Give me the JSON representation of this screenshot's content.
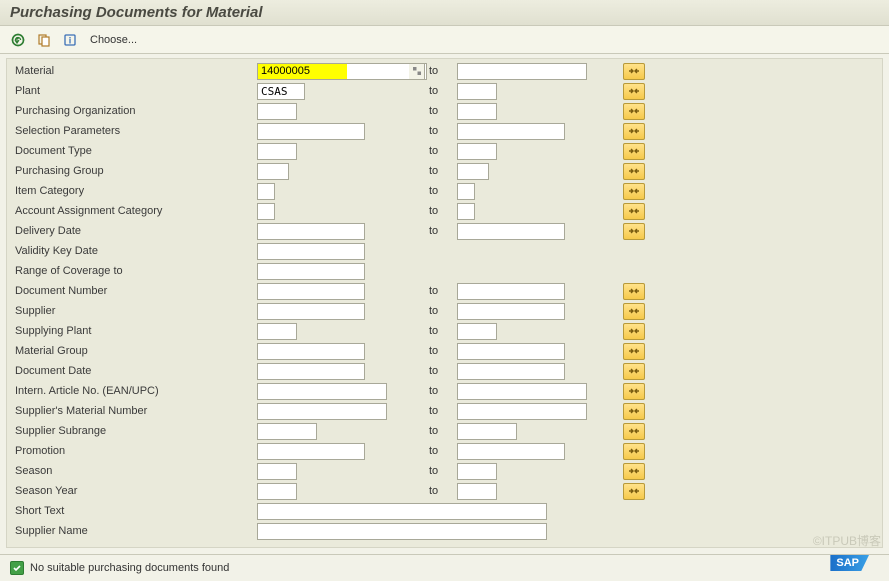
{
  "title": "Purchasing Documents for Material",
  "toolbar": {
    "choose": "Choose..."
  },
  "to": "to",
  "fields": {
    "material": {
      "label": "Material",
      "from": "14000005",
      "to": ""
    },
    "plant": {
      "label": "Plant",
      "from": "CSAS",
      "to": ""
    },
    "porg": {
      "label": "Purchasing Organization",
      "from": "",
      "to": ""
    },
    "selparam": {
      "label": "Selection Parameters",
      "from": "",
      "to": ""
    },
    "doctype": {
      "label": "Document Type",
      "from": "",
      "to": ""
    },
    "pgrp": {
      "label": "Purchasing Group",
      "from": "",
      "to": ""
    },
    "itemcat": {
      "label": "Item Category",
      "from": "",
      "to": ""
    },
    "acctasgn": {
      "label": "Account Assignment Category",
      "from": "",
      "to": ""
    },
    "deldate": {
      "label": "Delivery Date",
      "from": "",
      "to": ""
    },
    "validkey": {
      "label": "Validity Key Date",
      "value": ""
    },
    "rangecov": {
      "label": "Range of Coverage to",
      "value": ""
    },
    "docnum": {
      "label": "Document Number",
      "from": "",
      "to": ""
    },
    "supplier": {
      "label": "Supplier",
      "from": "",
      "to": ""
    },
    "supplant": {
      "label": "Supplying Plant",
      "from": "",
      "to": ""
    },
    "matgrp": {
      "label": "Material Group",
      "from": "",
      "to": ""
    },
    "docdate": {
      "label": "Document Date",
      "from": "",
      "to": ""
    },
    "ean": {
      "label": "Intern. Article No. (EAN/UPC)",
      "from": "",
      "to": ""
    },
    "supmatnr": {
      "label": "Supplier's Material Number",
      "from": "",
      "to": ""
    },
    "subrange": {
      "label": "Supplier Subrange",
      "from": "",
      "to": ""
    },
    "promo": {
      "label": "Promotion",
      "from": "",
      "to": ""
    },
    "season": {
      "label": "Season",
      "from": "",
      "to": ""
    },
    "seasonyr": {
      "label": "Season Year",
      "from": "",
      "to": ""
    },
    "shorttxt": {
      "label": "Short Text",
      "value": ""
    },
    "supname": {
      "label": "Supplier Name",
      "value": ""
    }
  },
  "status": "No suitable purchasing documents found",
  "logo": "SAP",
  "watermark": "©ITPUB博客"
}
